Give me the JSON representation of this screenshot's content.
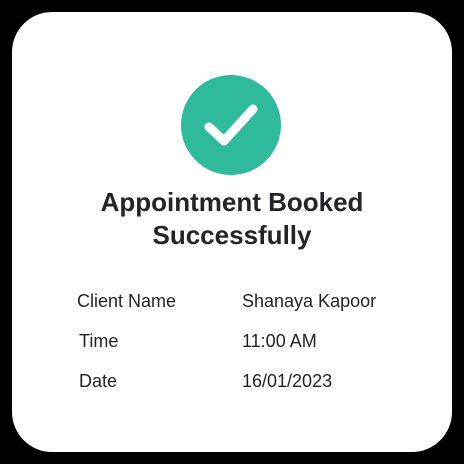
{
  "confirmation": {
    "title_line1": "Appointment Booked",
    "title_line2": "Successfully",
    "icon": "check-circle-icon",
    "accent_color": "#2fbb9b"
  },
  "details": {
    "client_name": {
      "label": "Client Name",
      "value": "Shanaya Kapoor"
    },
    "time": {
      "label": "Time",
      "value": "11:00 AM"
    },
    "date": {
      "label": "Date",
      "value": "16/01/2023"
    }
  }
}
